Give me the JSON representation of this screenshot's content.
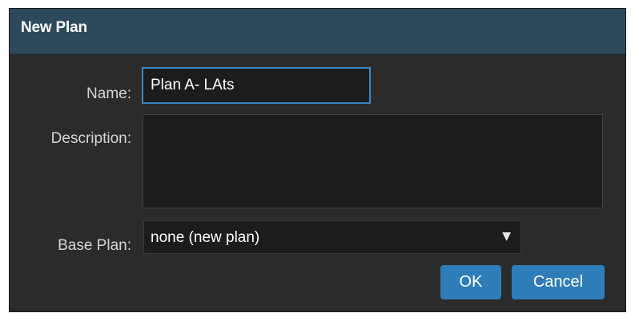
{
  "dialog": {
    "title": "New Plan",
    "name_label": "Name:",
    "name_value": "Plan A- LAts",
    "description_label": "Description:",
    "description_value": "",
    "base_plan_label": "Base Plan:",
    "base_plan_value": "none (new plan)",
    "ok_label": "OK",
    "cancel_label": "Cancel"
  },
  "colors": {
    "titlebar": "#2d4a5d",
    "dialog_bg": "#2b2b2b",
    "field_bg": "#1c1c1c",
    "focus_border": "#3a87c7",
    "button": "#2f7db8"
  },
  "icons": {
    "dropdown": "triangle-down"
  }
}
